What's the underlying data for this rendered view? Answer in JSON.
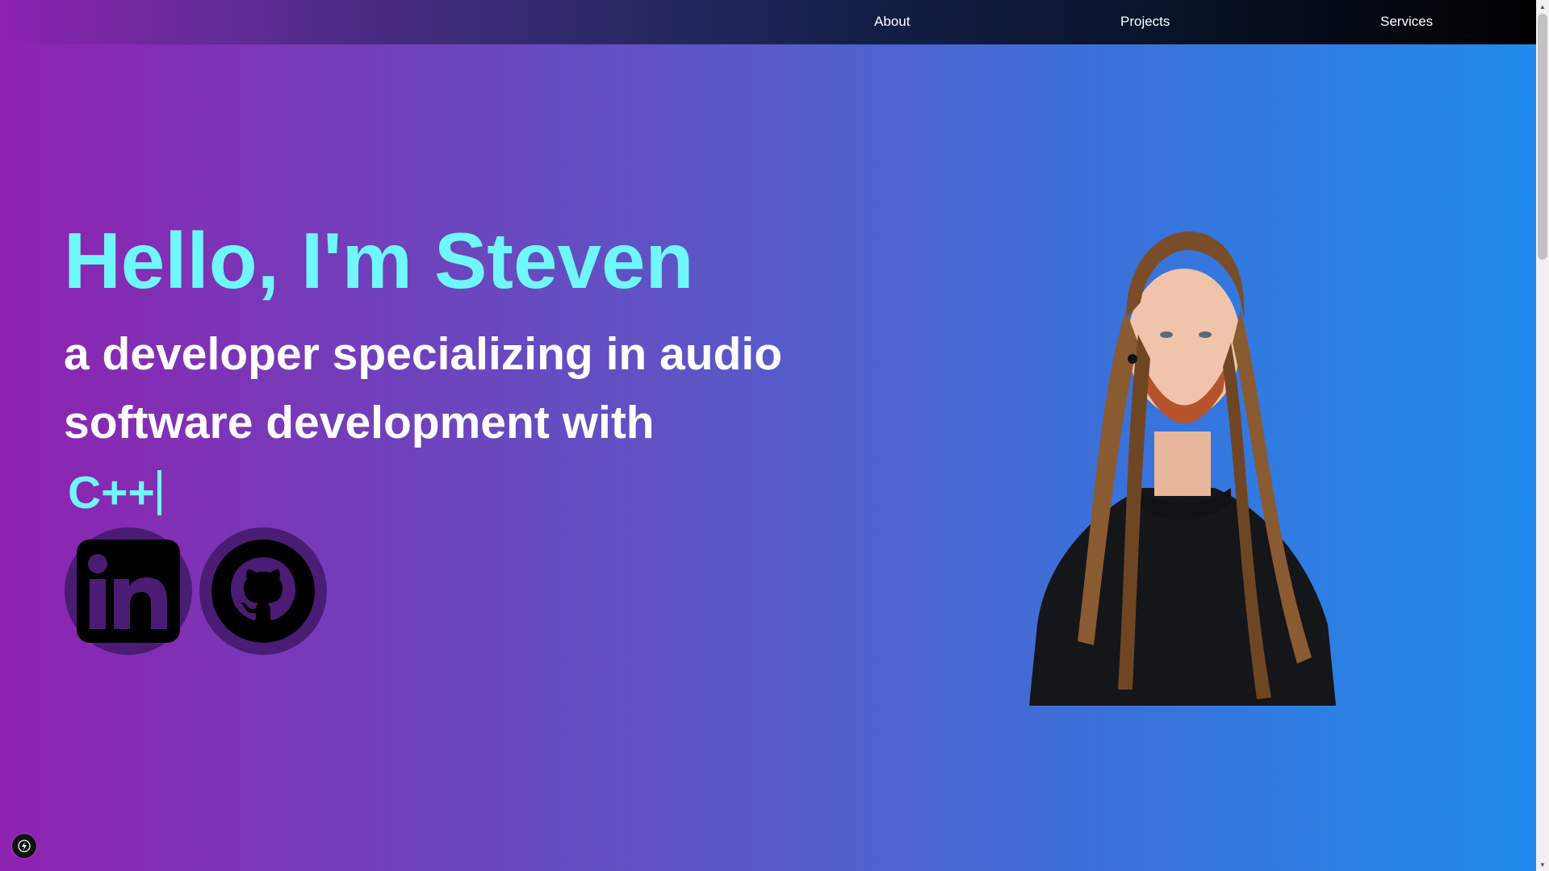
{
  "nav": {
    "links": [
      {
        "label": "About"
      },
      {
        "label": "Projects"
      },
      {
        "label": "Services"
      }
    ]
  },
  "hero": {
    "greeting": "Hello, I'm Steven",
    "tagline": "a developer specializing in audio software development with",
    "typed_text": "C++"
  },
  "social": {
    "items": [
      {
        "icon": "linkedin-icon"
      },
      {
        "icon": "github-icon"
      }
    ]
  },
  "colors": {
    "accent": "#6ff7fb",
    "text": "#ffffff",
    "gradient_start": "#8e22b0",
    "gradient_end": "#1f8ced",
    "social_circle": "#4a1c73"
  }
}
